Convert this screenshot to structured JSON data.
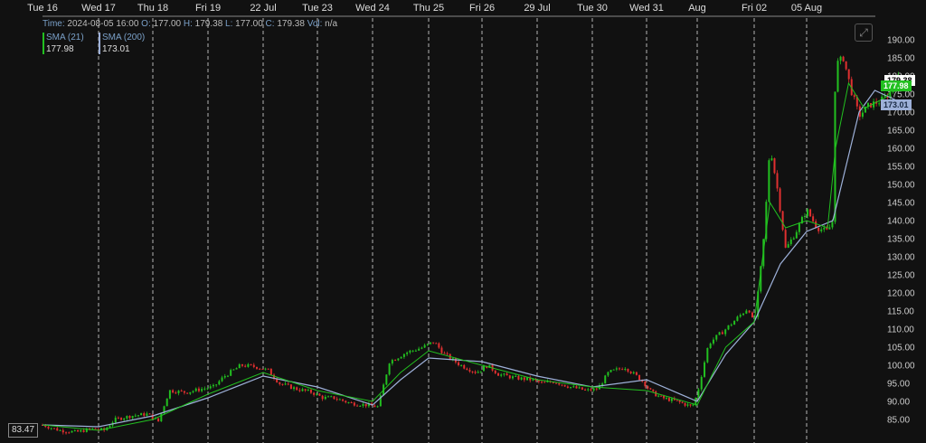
{
  "info": {
    "time_label": "Time:",
    "time": "2024-08-05 16:00",
    "open_label": "O:",
    "open": "177.00",
    "high_label": "H:",
    "high": "179.38",
    "low_label": "L:",
    "low": "177.00",
    "close_label": "C:",
    "close": "179.38",
    "vol_label": "Vol:",
    "vol": "n/a"
  },
  "legend": [
    {
      "name": "SMA (21)",
      "value": "177.98",
      "color": "#22c020"
    },
    {
      "name": "SMA (200)",
      "value": "173.01",
      "color": "#9db0d8"
    }
  ],
  "price_tags": {
    "last": "179.38",
    "sma21": "177.98",
    "sma200": "173.01",
    "left": "83.47"
  },
  "icons": {
    "expand": "expand-icon"
  },
  "colors": {
    "background": "#111111",
    "up": "#22c020",
    "down": "#e03030",
    "sma21": "#22c020",
    "sma200": "#9db0d8",
    "grid": "#dddddd"
  },
  "chart_data": {
    "type": "candlestick",
    "x_ticks": [
      "Tue 16",
      "Wed 17",
      "Thu 18",
      "Fri 19",
      "22 Jul",
      "Tue 23",
      "Wed 24",
      "Thu 25",
      "Fri 26",
      "29 Jul",
      "Tue 30",
      "Wed 31",
      "Aug",
      "Fri 02",
      "05 Aug"
    ],
    "y_ticks": [
      85,
      90,
      95,
      100,
      105,
      110,
      115,
      120,
      125,
      130,
      135,
      140,
      145,
      150,
      155,
      160,
      165,
      170,
      175,
      180,
      185,
      190
    ],
    "ylim": [
      81.5,
      193.5
    ],
    "grid": "vertical-dashed",
    "price_path": [
      [
        0,
        83.5
      ],
      [
        0.3,
        82
      ],
      [
        0.6,
        81.5
      ],
      [
        0.9,
        82.5
      ],
      [
        1.1,
        82
      ],
      [
        1.3,
        85
      ],
      [
        1.6,
        86
      ],
      [
        1.9,
        86.5
      ],
      [
        2.1,
        84.5
      ],
      [
        2.3,
        93
      ],
      [
        2.6,
        92.5
      ],
      [
        2.9,
        93.5
      ],
      [
        3.1,
        94
      ],
      [
        3.3,
        97
      ],
      [
        3.6,
        100
      ],
      [
        3.9,
        99.5
      ],
      [
        4.1,
        98.5
      ],
      [
        4.3,
        95
      ],
      [
        4.6,
        93.5
      ],
      [
        4.9,
        92.5
      ],
      [
        5.1,
        91
      ],
      [
        5.3,
        91
      ],
      [
        5.6,
        89.5
      ],
      [
        5.9,
        89
      ],
      [
        6.1,
        88.5
      ],
      [
        6.3,
        101
      ],
      [
        6.6,
        103.5
      ],
      [
        6.9,
        105
      ],
      [
        7.1,
        106.5
      ],
      [
        7.3,
        103
      ],
      [
        7.6,
        100
      ],
      [
        7.9,
        98
      ],
      [
        8.1,
        100
      ],
      [
        8.3,
        97.5
      ],
      [
        8.6,
        96.5
      ],
      [
        8.9,
        96
      ],
      [
        9.1,
        95
      ],
      [
        9.3,
        95.5
      ],
      [
        9.6,
        94
      ],
      [
        9.9,
        93
      ],
      [
        10.1,
        93.5
      ],
      [
        10.3,
        98
      ],
      [
        10.6,
        99.5
      ],
      [
        10.9,
        96
      ],
      [
        11.1,
        92.5
      ],
      [
        11.3,
        91
      ],
      [
        11.6,
        90
      ],
      [
        11.9,
        88.5
      ],
      [
        12.0,
        92
      ],
      [
        12.2,
        106
      ],
      [
        12.5,
        110
      ],
      [
        12.9,
        116
      ],
      [
        13.0,
        111
      ],
      [
        13.1,
        123
      ],
      [
        13.2,
        138
      ],
      [
        13.3,
        161
      ],
      [
        13.45,
        148
      ],
      [
        13.6,
        132
      ],
      [
        13.8,
        137
      ],
      [
        14.0,
        143
      ],
      [
        14.2,
        138
      ],
      [
        14.4,
        137
      ],
      [
        14.5,
        140
      ],
      [
        14.55,
        183
      ],
      [
        14.7,
        185
      ],
      [
        14.85,
        176
      ],
      [
        15.0,
        169
      ],
      [
        15.2,
        172
      ],
      [
        15.4,
        173
      ],
      [
        15.6,
        175.5
      ],
      [
        15.75,
        179.4
      ]
    ],
    "sma21": [
      [
        0,
        83.5
      ],
      [
        1.0,
        82
      ],
      [
        2.0,
        85
      ],
      [
        3.0,
        92
      ],
      [
        4.0,
        98
      ],
      [
        5.0,
        93
      ],
      [
        6.0,
        90
      ],
      [
        6.5,
        98
      ],
      [
        7.0,
        104
      ],
      [
        8.0,
        100
      ],
      [
        9.0,
        96
      ],
      [
        10.0,
        94
      ],
      [
        11.0,
        93
      ],
      [
        12.0,
        89
      ],
      [
        12.5,
        105
      ],
      [
        13.0,
        112
      ],
      [
        13.3,
        145
      ],
      [
        13.6,
        138
      ],
      [
        14.0,
        140
      ],
      [
        14.4,
        138
      ],
      [
        14.55,
        160
      ],
      [
        14.8,
        178
      ],
      [
        15.1,
        171
      ],
      [
        15.5,
        174
      ],
      [
        15.75,
        178
      ]
    ],
    "sma200": [
      [
        0,
        83.5
      ],
      [
        1.0,
        83
      ],
      [
        2.0,
        86
      ],
      [
        3.0,
        91
      ],
      [
        4.0,
        97
      ],
      [
        5.0,
        94
      ],
      [
        6.0,
        89
      ],
      [
        6.5,
        96
      ],
      [
        7.0,
        102
      ],
      [
        8.0,
        101
      ],
      [
        9.0,
        97
      ],
      [
        10.0,
        94
      ],
      [
        11.0,
        96
      ],
      [
        12.0,
        90
      ],
      [
        12.5,
        103
      ],
      [
        13.0,
        112
      ],
      [
        13.5,
        128
      ],
      [
        14.0,
        137
      ],
      [
        14.5,
        140
      ],
      [
        15.0,
        170
      ],
      [
        15.3,
        176
      ],
      [
        15.75,
        173
      ]
    ]
  }
}
